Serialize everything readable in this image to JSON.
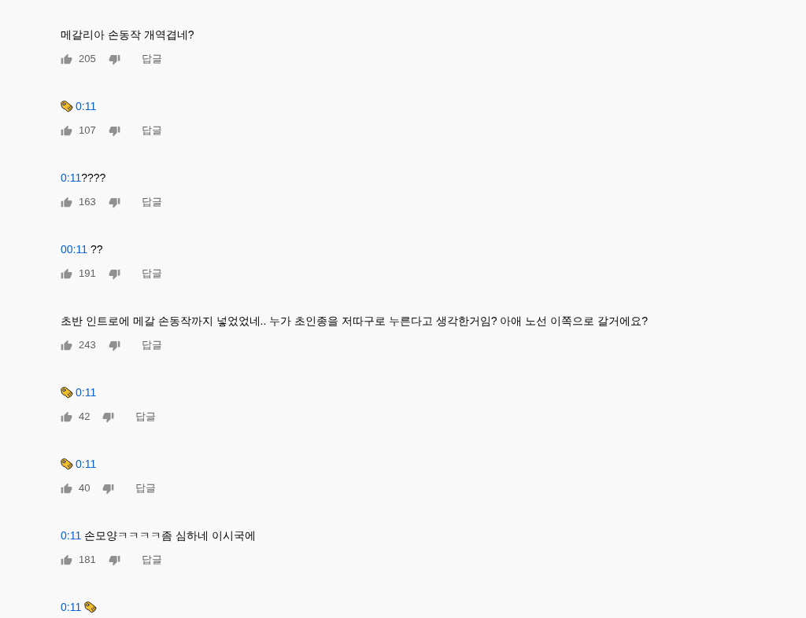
{
  "comments": [
    {
      "content": [
        {
          "kind": "text",
          "text": "메갈리아 손동작 개역겹네?"
        }
      ],
      "likes": "205",
      "reply": "답글"
    },
    {
      "content": [
        {
          "kind": "emoji"
        },
        {
          "kind": "link",
          "text": "0:11"
        }
      ],
      "likes": "107",
      "reply": "답글"
    },
    {
      "content": [
        {
          "kind": "link",
          "text": "0:11"
        },
        {
          "kind": "text",
          "text": "????"
        }
      ],
      "likes": "163",
      "reply": "답글"
    },
    {
      "content": [
        {
          "kind": "link",
          "text": "00:11"
        },
        {
          "kind": "text",
          "text": " ??"
        }
      ],
      "likes": "191",
      "reply": "답글"
    },
    {
      "content": [
        {
          "kind": "text",
          "text": "초반 인트로에 메갈 손동작까지 넣었었네.. 누가 초인종을 저따구로 누른다고 생각한거임? 아애 노선 이쪽으로 갈거에요?"
        }
      ],
      "likes": "243",
      "reply": "답글"
    },
    {
      "content": [
        {
          "kind": "emoji"
        },
        {
          "kind": "link",
          "text": "0:11"
        }
      ],
      "likes": "42",
      "reply": "답글"
    },
    {
      "content": [
        {
          "kind": "emoji"
        },
        {
          "kind": "link",
          "text": "0:11"
        }
      ],
      "likes": "40",
      "reply": "답글"
    },
    {
      "content": [
        {
          "kind": "link",
          "text": "0:11"
        },
        {
          "kind": "text",
          "text": " 손모양ㅋㅋㅋㅋ좀 심하네 이시국에"
        }
      ],
      "likes": "181",
      "reply": "답글"
    },
    {
      "content": [
        {
          "kind": "link",
          "text": "0:11"
        },
        {
          "kind": "emoji"
        }
      ]
    }
  ]
}
